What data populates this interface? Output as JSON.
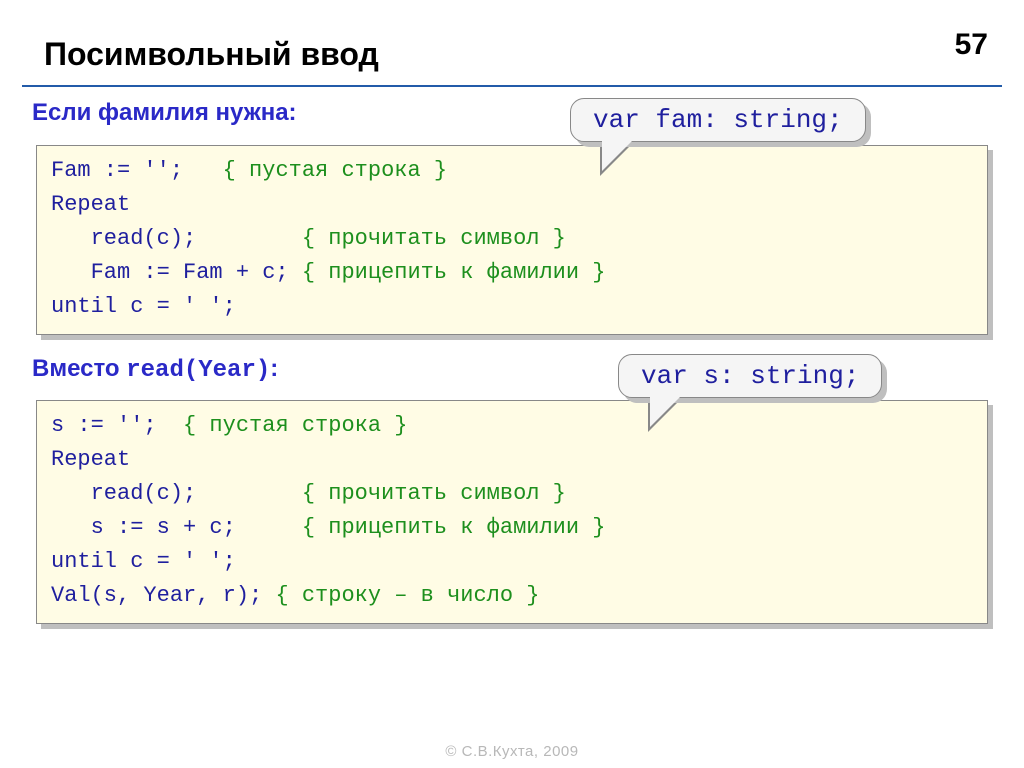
{
  "page_number": "57",
  "title": "Посимвольный ввод",
  "section1": {
    "label": "Если фамилия нужна:",
    "callout": "var fam: string;",
    "code": {
      "l1a": "Fam := '';   ",
      "l1c": "{ пустая строка }",
      "l2": "Repeat",
      "l3a": "   read(c);        ",
      "l3c": "{ прочитать символ }",
      "l4a": "   Fam := Fam + c; ",
      "l4c": "{ прицепить к фамилии }",
      "l5": "until c = ' ';"
    }
  },
  "section2": {
    "label_prefix": "Вместо ",
    "label_mono": "read(Year)",
    "label_suffix": ":",
    "callout": "var s: string;",
    "code": {
      "l1a": "s := '';  ",
      "l1c": "{ пустая строка }",
      "l2": "Repeat",
      "l3a": "   read(c);        ",
      "l3c": "{ прочитать символ }",
      "l4a": "   s := s + c;     ",
      "l4c": "{ прицепить к фамилии }",
      "l5": "until c = ' ';",
      "l6a": "Val(s, Year, r); ",
      "l6c": "{ строку – в число }"
    }
  },
  "footer": "© С.В.Кухта, 2009"
}
